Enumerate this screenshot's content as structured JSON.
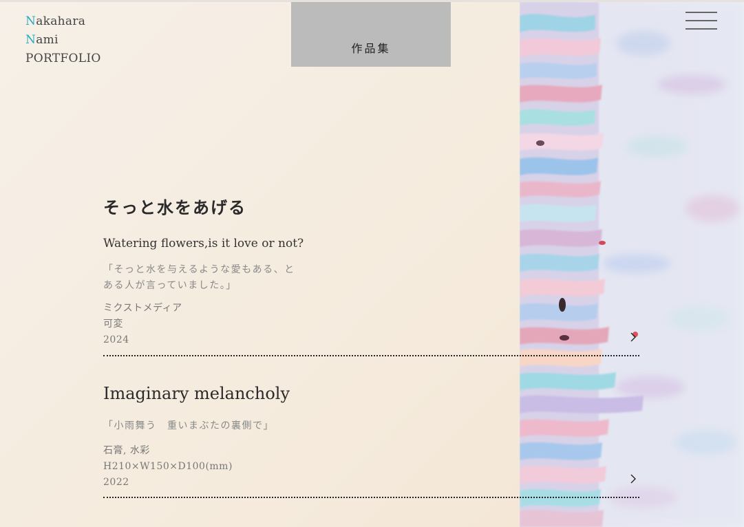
{
  "site": {
    "logo_line1_initial": "N",
    "logo_line1_rest": "akahara",
    "logo_line2_initial": "N",
    "logo_line2_rest": "ami",
    "logo_line3": "PORTFOLIO",
    "accent_color": "#29a9c4"
  },
  "nav": {
    "tab_label": "作品集",
    "menu_icon": "hamburger-menu-icon"
  },
  "works": [
    {
      "title": "そっと水をあげる",
      "subtitle": "Watering flowers,is it love or not?",
      "quote": "「そっと水を与えるような愛もある、とある人が言っていました。」",
      "medium": "ミクストメディア",
      "size": "可変",
      "year": "2024",
      "arrow_icon": "chevron-right-icon"
    },
    {
      "title": "Imaginary melancholy",
      "quote": "「小雨舞う　重いまぶたの裏側で」",
      "medium": "石膏, 水彩",
      "size": "H210×W150×D100(mm)",
      "year": "2022",
      "arrow_icon": "chevron-right-icon"
    }
  ]
}
